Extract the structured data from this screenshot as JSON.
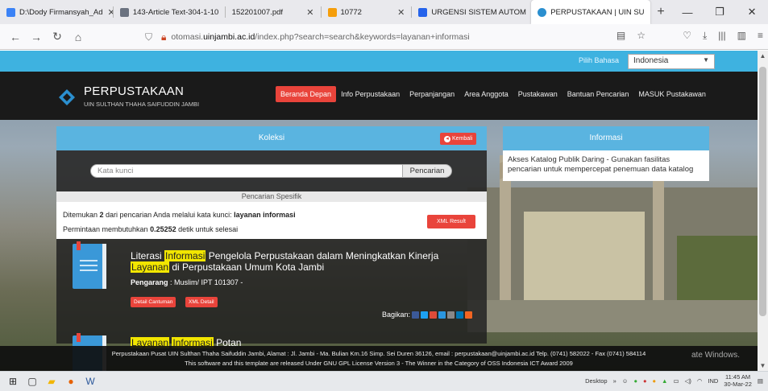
{
  "browser": {
    "tabs": [
      {
        "title": "D:\\Dody Firmansyah_Ad",
        "color": "#3b82f6"
      },
      {
        "title": "143-Article Text-304-1-10",
        "color": "#6b7280"
      },
      {
        "title": "152201007.pdf",
        "color": "#ffffff"
      },
      {
        "title": "10772",
        "color": "#f59e0b"
      },
      {
        "title": "URGENSI SISTEM AUTOM",
        "color": "#2563eb"
      },
      {
        "title": "PERPUSTAKAAN | UIN SU",
        "color": "#2b8fcf"
      }
    ],
    "url_prefix": "otomasi.",
    "url_host": "uinjambi.ac.id",
    "url_path": "/index.php?search=search&keywords=layanan+informasi"
  },
  "site": {
    "lang_label": "Pilih Bahasa",
    "lang_value": "Indonesia",
    "brand": "PERPUSTAKAAN",
    "brand_sub": "UIN SULTHAN THAHA SAIFUDDIN JAMBI",
    "menu": [
      "Beranda Depan",
      "Info Perpustakaan",
      "Perpanjangan",
      "Area Anggota",
      "Pustakawan",
      "Bantuan Pencarian",
      "MASUK Pustakawan"
    ],
    "koleksi_title": "Koleksi",
    "kembali": "Kembali",
    "search_placeholder": "Kata kunci",
    "search_button": "Pencarian",
    "spesifik": "Pencarian Spesifik",
    "found_pre": "Ditemukan ",
    "found_count": "2",
    "found_mid": " dari pencarian Anda melalui kata kunci: ",
    "found_keyword": "layanan informasi",
    "time_pre": "Permintaan membutuhkan ",
    "time_value": "0.25252",
    "time_post": " detik untuk selesai",
    "xml_result": "XML Result",
    "result1": {
      "t1": "Literasi ",
      "hl1": "Informasi",
      "t2": " Pengelola Perpustakaan dalam Meningkatkan Kinerja ",
      "hl2": "Layanan",
      "t3": " di Perpustakaan Umum Kota Jambi",
      "author_label": "Pengarang",
      "author": " : Muslim/ IPT 101307 -",
      "btn_detail": "Detail Cantuman",
      "btn_xml": "XML Detail",
      "share": "Bagikan:"
    },
    "result2_t": "Potan",
    "result2_hl1": "Layanan",
    "result2_hl2": "Informasi",
    "info_title": "Informasi",
    "info_text": "Akses Katalog Publik Daring - Gunakan fasilitas pencarian untuk mempercepat penemuan data katalog",
    "footer1": "Perpustakaan Pusat UIN Sulthan Thaha Saifuddin Jambi, Alamat : Jl. Jambi - Ma. Bulian Km.16 Simp. Sei Duren 36126, email : perpustakaan@uinjambi.ac.id Telp. (0741) 582022 - Fax (0741) 584114",
    "footer2": "This software and this template are released Under GNU GPL License Version 3 - The Winner in the Category of OSS Indonesia ICT Award 2009",
    "watermark": "ate Windows."
  },
  "taskbar": {
    "desktop": "Desktop",
    "lang": "IND",
    "time": "11:45 AM",
    "date": "30-Mar-22"
  }
}
